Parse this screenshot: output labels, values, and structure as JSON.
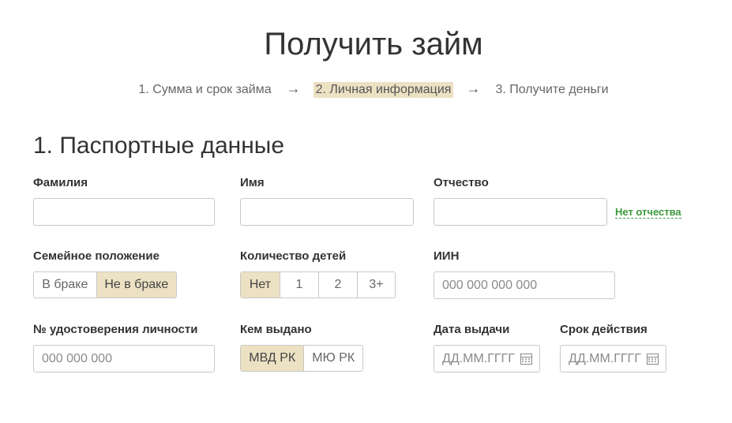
{
  "header": {
    "title": "Получить займ"
  },
  "steps": [
    {
      "label": "1. Сумма и срок займа",
      "active": false
    },
    {
      "label": "2. Личная информация",
      "active": true
    },
    {
      "label": "3. Получите деньги",
      "active": false
    }
  ],
  "step_arrow": "→",
  "section": {
    "title": "1. Паспортные данные"
  },
  "fields": {
    "last_name": {
      "label": "Фамилия",
      "value": ""
    },
    "first_name": {
      "label": "Имя",
      "value": ""
    },
    "patronymic": {
      "label": "Отчество",
      "value": "",
      "no_patronymic_link": "Нет отчества"
    },
    "marital_status": {
      "label": "Семейное положение",
      "options": [
        "В браке",
        "Не в браке"
      ],
      "selected": "Не в браке"
    },
    "children": {
      "label": "Количество детей",
      "options": [
        "Нет",
        "1",
        "2",
        "3+"
      ],
      "selected": "Нет"
    },
    "iin": {
      "label": "ИИН",
      "placeholder": "000 000 000 000"
    },
    "id_number": {
      "label": "№ удостоверения личности",
      "placeholder": "000 000 000"
    },
    "issued_by": {
      "label": "Кем выдано",
      "options": [
        "МВД РК",
        "МЮ РК"
      ],
      "selected": "МВД РК"
    },
    "issue_date": {
      "label": "Дата выдачи",
      "placeholder": "ДД.ММ.ГГГГ"
    },
    "expiry_date": {
      "label": "Срок действия",
      "placeholder": "ДД.ММ.ГГГГ"
    }
  },
  "colors": {
    "selected_bg": "#ece1c3",
    "link": "#3a9a3a",
    "border": "#c8c8c8"
  }
}
